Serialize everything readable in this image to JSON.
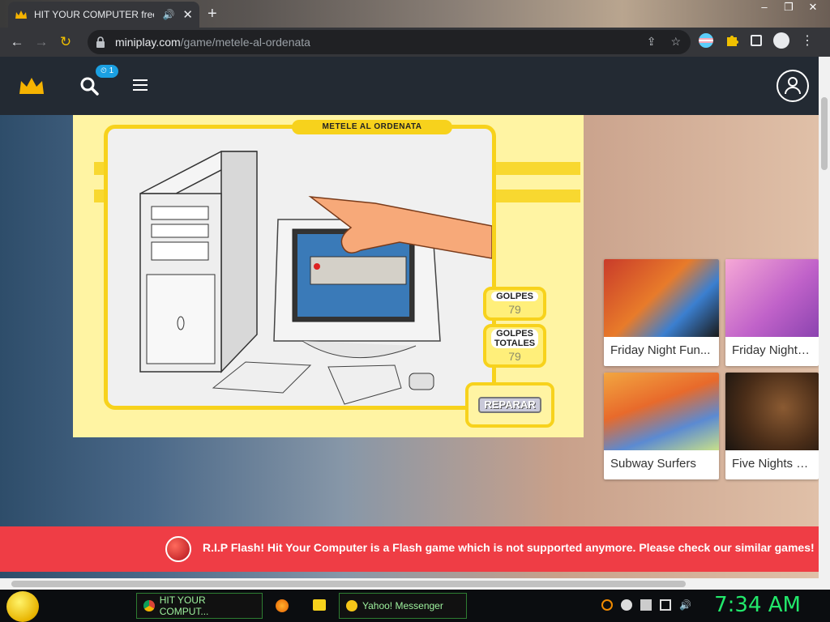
{
  "browser": {
    "tab_title": "HIT YOUR COMPUTER free o",
    "url_host": "miniplay.com",
    "url_path": "/game/metele-al-ordenata"
  },
  "site": {
    "badge_text": "⏲ 1"
  },
  "game": {
    "title": "METELE AL ORDENATA",
    "hits_label": "GOLPES",
    "hits_value": "79",
    "total_hits_label": "GOLPES TOTALES",
    "total_hits_value": "79",
    "repair_label": "REPARAR"
  },
  "similar_games": [
    {
      "name": "Friday Night Fun..."
    },
    {
      "name": "Friday Night Fun"
    },
    {
      "name": "Subway Surfers"
    },
    {
      "name": "Five Nights at Fr"
    }
  ],
  "flash_notice": "R.I.P Flash! Hit Your Computer is a Flash game which is not supported anymore. Please check our similar games!",
  "taskbar": {
    "chrome_label": "HIT YOUR COMPUT...",
    "messenger_label": "Yahoo! Messenger",
    "clock": "7:34 AM"
  },
  "colors": {
    "accent_yellow": "#f7d21c",
    "flash_red": "#ef3d45",
    "clock_green": "#22e86b"
  }
}
